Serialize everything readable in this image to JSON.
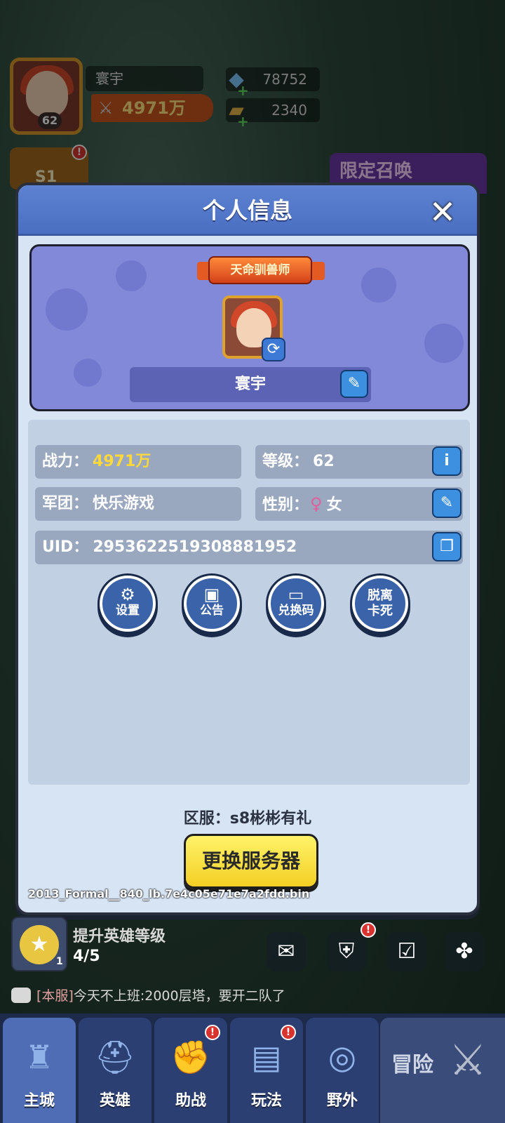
{
  "hud": {
    "player_name": "寰宇",
    "level": "62",
    "power": "4971万",
    "gems": "78752",
    "tickets": "2340",
    "season_badge": "S1",
    "summon_banner": "限定召唤"
  },
  "dialog": {
    "title": "个人信息",
    "close_symbol": "✕",
    "profile": {
      "title_badge": "天命驯兽师",
      "name": "寰宇"
    },
    "info": {
      "power_label": "战力：",
      "power_value": "4971万",
      "level_label": "等级：",
      "level_value": "62",
      "guild_label": "军团：",
      "guild_value": "快乐游戏",
      "gender_label": "性别：",
      "gender_value": "女",
      "uid_label": "UID：",
      "uid_value": "2953622519308881952"
    },
    "actions": [
      {
        "label": "设置",
        "icon": "gear-icon"
      },
      {
        "label": "公告",
        "icon": "notice-icon"
      },
      {
        "label": "兑换码",
        "icon": "ticket-icon"
      },
      {
        "label": "脱离卡死",
        "icon": ""
      }
    ],
    "action_labels": {
      "settings": "设置",
      "notice": "公告",
      "redeem": "兑换码",
      "unstuck_line1": "脱离",
      "unstuck_line2": "卡死"
    },
    "server": "区服：s8彬彬有礼",
    "change_server": "更换服务器",
    "debug": "2013_Formal__840_lb.7e4c05e71e7a2fdd.bin"
  },
  "quest": {
    "title": "提升英雄等级",
    "progress": "4/5",
    "count": "1"
  },
  "chat": {
    "channel": "[本服]",
    "message": "今天不上班:2000层塔，要开二队了"
  },
  "nav": {
    "items": [
      "主城",
      "英雄",
      "助战",
      "玩法",
      "野外"
    ],
    "adventure": "冒险"
  },
  "colors": {
    "header_blue": "#4a6fc2",
    "power_gold": "#ffd83b",
    "button_yellow": "#f3cf24",
    "notification_red": "#d7342f"
  }
}
